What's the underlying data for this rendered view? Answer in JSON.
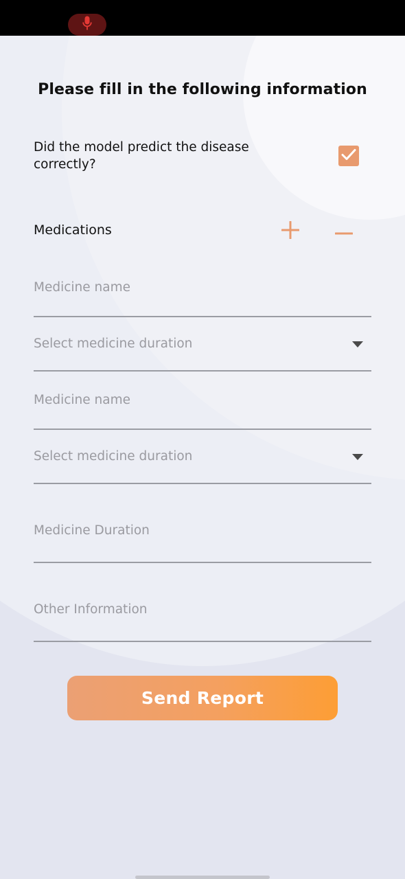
{
  "status_bar": {
    "mic_indicator_icon": "microphone-icon",
    "mic_color": "#e53935"
  },
  "form": {
    "title": "Please fill in the following information",
    "prediction_question": "Did the model predict the disease correctly?",
    "prediction_correct_checked": true,
    "medications": {
      "label": "Medications",
      "add_icon": "plus-icon",
      "remove_icon": "minus-icon",
      "entries": [
        {
          "name_placeholder": "Medicine name",
          "name_value": "",
          "duration_placeholder": "Select medicine duration",
          "duration_value": ""
        },
        {
          "name_placeholder": "Medicine name",
          "name_value": "",
          "duration_placeholder": "Select medicine duration",
          "duration_value": ""
        }
      ]
    },
    "medicine_duration_placeholder": "Medicine Duration",
    "other_information_placeholder": "Other Information",
    "submit_label": "Send Report"
  },
  "colors": {
    "accent": "#e89a6e",
    "button_gradient_start": "#eba074",
    "button_gradient_end": "#fd9e35",
    "text_primary": "#111111",
    "placeholder": "#9a9aa0",
    "background": "#e3e5f0"
  }
}
